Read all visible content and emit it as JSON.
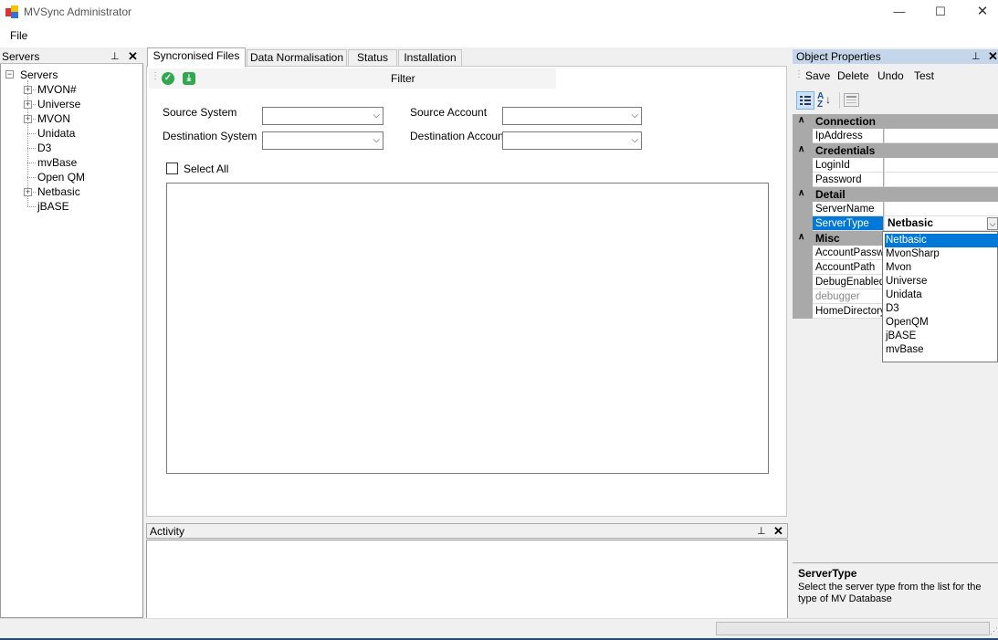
{
  "window": {
    "title": "MVSync Administrator",
    "minimize": "—",
    "maximize": "☐",
    "close": "✕"
  },
  "menu": {
    "file": "File"
  },
  "servers_panel": {
    "title": "Servers",
    "pin": "ᵖ",
    "close": "✕",
    "root": "Servers",
    "items": [
      {
        "label": "MVON#",
        "expandable": true
      },
      {
        "label": "Universe",
        "expandable": true
      },
      {
        "label": "MVON",
        "expandable": true
      },
      {
        "label": "Unidata",
        "expandable": false
      },
      {
        "label": "D3",
        "expandable": false
      },
      {
        "label": "mvBase",
        "expandable": false
      },
      {
        "label": "Open QM",
        "expandable": false
      },
      {
        "label": "Netbasic",
        "expandable": true
      },
      {
        "label": "jBASE",
        "expandable": false
      }
    ]
  },
  "tabs": [
    "Syncronised Files",
    "Data Normalisation",
    "Status",
    "Installation"
  ],
  "toolbar": {
    "filter_label": "Filter",
    "check_icon": "check-circle-icon",
    "download_icon": "download-icon"
  },
  "form": {
    "source_system": "Source System",
    "destination_system": "Destination System",
    "source_account": "Source Account",
    "destination_account": "Destination Account",
    "select_all": "Select All"
  },
  "activity": {
    "title": "Activity"
  },
  "props": {
    "title": "Object Properties",
    "toolbar": [
      "Save",
      "Delete",
      "Undo",
      "Test"
    ],
    "categories": {
      "connection": "Connection",
      "credentials": "Credentials",
      "detail": "Detail",
      "misc": "Misc"
    },
    "rows": {
      "ipaddress": "IpAddress",
      "loginid": "LoginId",
      "password": "Password",
      "servername": "ServerName",
      "servertype": "ServerType",
      "servertype_value": "Netbasic",
      "accountpassword": "AccountPassword",
      "accountpath": "AccountPath",
      "debugenabled": "DebugEnabled",
      "debugger": "debugger",
      "homedirectory": "HomeDirectory"
    },
    "dropdown_options": [
      "Netbasic",
      "MvonSharp",
      "Mvon",
      "Universe",
      "Unidata",
      "D3",
      "OpenQM",
      "jBASE",
      "mvBase"
    ],
    "help_title": "ServerType",
    "help_text": "Select the server type from the list for the type of MV Database"
  },
  "colors": {
    "accent": "#0078d7",
    "category": "#a9a9a9",
    "header_active": "#c6d6ea",
    "status_line": "#254a7e"
  }
}
